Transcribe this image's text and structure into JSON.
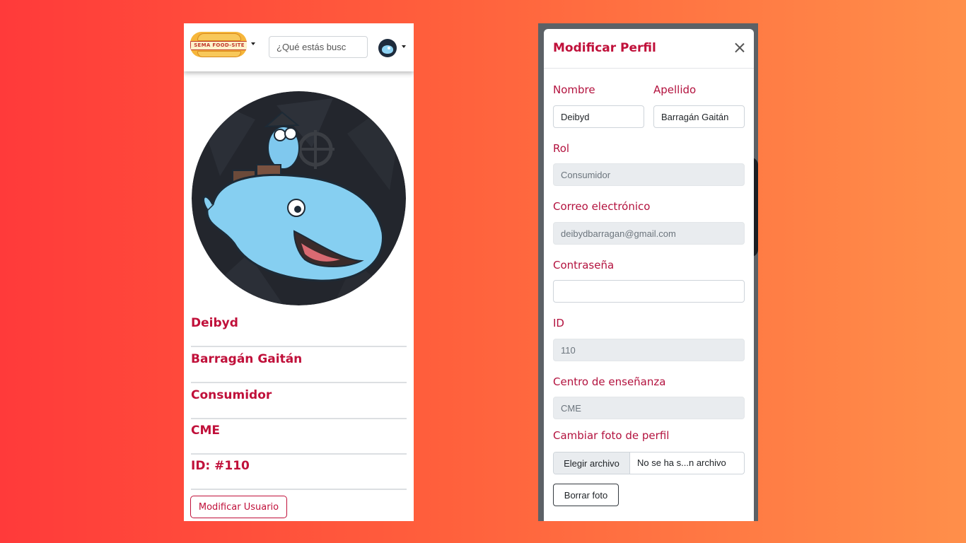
{
  "left": {
    "brand": {
      "logo_text": "SEMA FOOD-SITE"
    },
    "search": {
      "placeholder": "¿Qué estás busc"
    },
    "profile": {
      "first_name": "Deibyd",
      "last_name": "Barragán Gaitán",
      "role": "Consumidor",
      "center": "CME",
      "id": "ID: #110"
    },
    "modify_button": "Modificar Usuario"
  },
  "modal": {
    "title": "Modificar Perfil",
    "labels": {
      "nombre": "Nombre",
      "apellido": "Apellido",
      "rol": "Rol",
      "correo": "Correo electrónico",
      "contrasena": "Contraseña",
      "id": "ID",
      "centro": "Centro de enseñanza",
      "foto": "Cambiar foto de perfil"
    },
    "values": {
      "nombre": "Deibyd",
      "apellido": "Barragán Gaitán",
      "rol": "Consumidor",
      "correo": "deibydbarragan@gmail.com",
      "contrasena": "",
      "id": "110",
      "centro": "CME"
    },
    "file_choose": "Elegir archivo",
    "file_status": "No se ha s...n archivo",
    "delete_photo": "Borrar foto"
  },
  "icons": {
    "close": "close-icon",
    "brand_caret": "chevron-down-icon",
    "avatar_caret": "chevron-down-icon"
  },
  "colors": {
    "accent": "#c0103a",
    "background_gradient_start": "#ff3a3a",
    "background_gradient_end": "#ff8f4a"
  }
}
